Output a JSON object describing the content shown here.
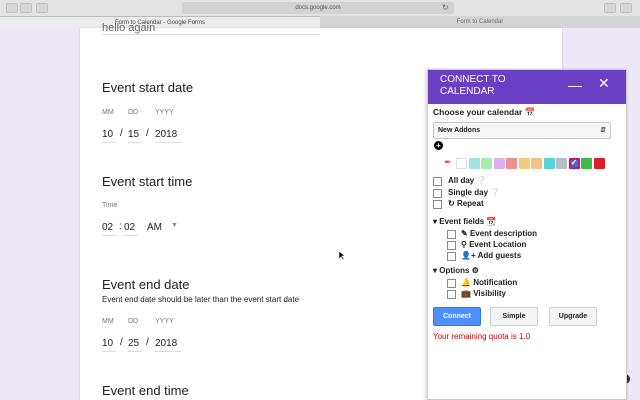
{
  "browser": {
    "url": "docs.google.com",
    "tabs": [
      {
        "label": "Form to Calendar - Google Forms",
        "active": true
      },
      {
        "label": "Form to Calendar",
        "active": false
      }
    ]
  },
  "form": {
    "cut_text": "hello again",
    "questions": [
      {
        "title": "Event start date",
        "mm_label": "MM",
        "dd_label": "DD",
        "yyyy_label": "YYYY",
        "mm": "10",
        "dd": "15",
        "yyyy": "2018"
      },
      {
        "title": "Event start time",
        "time_label": "Time",
        "hour": "02",
        "minute": "02",
        "ampm": "AM"
      },
      {
        "title": "Event end date",
        "description": "Event end date should be later than the event start date",
        "mm_label": "MM",
        "dd_label": "DD",
        "yyyy_label": "YYYY",
        "mm": "10",
        "dd": "25",
        "yyyy": "2018"
      },
      {
        "title": "Event end time"
      }
    ],
    "slash": "/",
    "colon": ":"
  },
  "panel": {
    "title": "CONNECT TO CALENDAR",
    "minimize_icon": "minimize-icon",
    "close_icon": "close-icon",
    "choose_label": "Choose your calendar",
    "calendar_selected": "New Addons",
    "swatch_colors": [
      "#ffffff",
      "#a4e1e1",
      "#a8ecb2",
      "#dcb3f0",
      "#f08f8f",
      "#f3c97a",
      "#f7bf84",
      "#58d3d6",
      "#b7bec6",
      "#3b6fd6",
      "#3bb94b",
      "#dc1f27"
    ],
    "selected_swatch_index": 9,
    "options": [
      {
        "label": "All day",
        "icon": "question-circle-icon"
      },
      {
        "label": "Single day",
        "icon": "question-circle-icon"
      },
      {
        "label": "Repeat",
        "icon": "redo-icon"
      }
    ],
    "event_fields_label": "Event fields",
    "event_fields": [
      {
        "label": "Event description",
        "icon": "edit-icon"
      },
      {
        "label": "Event Location",
        "icon": "map-marker-icon"
      },
      {
        "label": "Add guests",
        "icon": "user-plus-icon"
      }
    ],
    "options_label": "Options",
    "option_items": [
      {
        "label": "Notification",
        "icon": "bell-icon"
      },
      {
        "label": "Visibility",
        "icon": "briefcase-icon"
      }
    ],
    "connect_label": "Connect",
    "simple_label": "Simple",
    "upgrade_label": "Upgrade",
    "quota_text": "Your remaining quota is 1.0",
    "accent_color": "#6a3fc4",
    "quota_color": "#d50000"
  }
}
